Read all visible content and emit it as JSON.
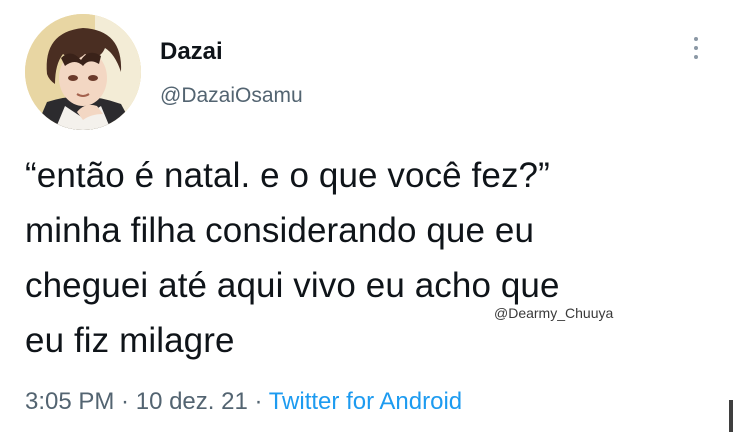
{
  "author": {
    "display_name": "Dazai",
    "handle": "@DazaiOsamu",
    "avatar_icon": "anime-avatar"
  },
  "tweet": {
    "lines": [
      "“então é natal. e o que você fez?”",
      "minha filha considerando que eu",
      "cheguei até aqui vivo eu acho que",
      "eu fiz milagre"
    ],
    "watermark": "@Dearmy_Chuuya"
  },
  "meta": {
    "time": "3:05 PM",
    "sep1": " · ",
    "date": "10 dez. 21",
    "sep2": " · ",
    "source": "Twitter for Android"
  },
  "menu": {
    "icon": "more-vertical-icon"
  },
  "colors": {
    "text": "#0f1419",
    "secondary": "#536471",
    "link": "#1d9bf0",
    "background": "#ffffff"
  }
}
